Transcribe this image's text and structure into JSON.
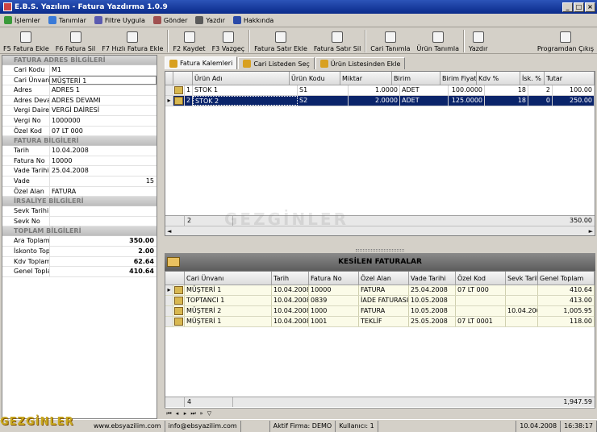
{
  "window": {
    "title": "E.B.S. Yazılım   -   Fatura Yazdırma 1.0.9",
    "min": "_",
    "max": "□",
    "close": "×"
  },
  "menu": [
    {
      "label": "İşlemler",
      "color": "#3a9a3a"
    },
    {
      "label": "Tanımlar",
      "color": "#3a7ad8"
    },
    {
      "label": "Filtre Uygula",
      "color": "#5a5ab0"
    },
    {
      "label": "Gönder",
      "color": "#a05050"
    },
    {
      "label": "Yazdır",
      "color": "#5a5a5a"
    },
    {
      "label": "Hakkında",
      "color": "#2a4aa8"
    }
  ],
  "toolbar": {
    "buttons": [
      "F5 Fatura Ekle",
      "F6 Fatura Sil",
      "F7 Hızlı Fatura Ekle",
      "F2 Kaydet",
      "F3 Vazgeç",
      "Fatura Satır Ekle",
      "Fatura Satır Sil",
      "Cari Tanımla",
      "Ürün Tanımla",
      "Yazdır",
      "Programdan Çıkış"
    ]
  },
  "left": {
    "fatura_adres": {
      "title": "FATURA ADRES BİLGİLERİ",
      "rows": [
        [
          "Cari Kodu",
          "M1"
        ],
        [
          "Cari Ünvanı",
          "MÜŞTERİ 1"
        ],
        [
          "Adres",
          "ADRES 1"
        ],
        [
          "Adres Devamı",
          "ADRES DEVAMI"
        ],
        [
          "Vergi Dairesi",
          "VERGİ DAİRESİ"
        ],
        [
          "Vergi No",
          "1000000"
        ],
        [
          "Özel Kod",
          "07 LT 000"
        ]
      ]
    },
    "fatura": {
      "title": "FATURA BİLGİLERİ",
      "rows": [
        [
          "Tarih",
          "10.04.2008"
        ],
        [
          "Fatura No",
          "10000"
        ],
        [
          "Vade Tarihi",
          "25.04.2008"
        ],
        [
          "Vade",
          ""
        ],
        [
          "Özel Alan",
          "FATURA"
        ]
      ],
      "vade_value": "15"
    },
    "irsaliye": {
      "title": "İRSALİYE BİLGİLERİ",
      "rows": [
        [
          "Sevk Tarihi",
          ""
        ],
        [
          "Sevk No",
          ""
        ]
      ]
    },
    "toplam": {
      "title": "TOPLAM BİLGİLERİ",
      "rows": [
        [
          "Ara Toplam",
          "350.00"
        ],
        [
          "İskonto Toplam",
          "2.00"
        ],
        [
          "Kdv Toplamı",
          "62.64"
        ],
        [
          "Genel Toplam",
          "410.64"
        ]
      ]
    }
  },
  "tabs": [
    "Fatura Kalemleri",
    "Cari Listeden Seç",
    "Ürün Listesinden Ekle"
  ],
  "grid1": {
    "headers": [
      "Ürün Adı",
      "Ürün Kodu",
      "Miktar",
      "Birim",
      "Birim Fiyat",
      "Kdv %",
      "İsk. %",
      "Tutar"
    ],
    "rows": [
      [
        "1",
        "STOK 1",
        "S1",
        "1.0000",
        "ADET",
        "100.0000",
        "18",
        "2",
        "100.00"
      ],
      [
        "2",
        "STOK 2",
        "S2",
        "2.0000",
        "ADET",
        "125.0000",
        "18",
        "0",
        "250.00"
      ]
    ],
    "footer_count": "2",
    "footer_total": "350.00"
  },
  "panel2": {
    "title": "KESİLEN FATURALAR"
  },
  "grid2": {
    "headers": [
      "Cari Ünvanı",
      "Tarih",
      "Fatura No",
      "Özel Alan",
      "Vade Tarihi",
      "Özel Kod",
      "Sevk Tarihi",
      "Genel Toplam"
    ],
    "rows": [
      [
        "MÜŞTERİ 1",
        "10.04.2008",
        "10000",
        "FATURA",
        "25.04.2008",
        "07 LT 000",
        "",
        "410.64"
      ],
      [
        "TOPTANCI 1",
        "10.04.2008",
        "0839",
        "İADE FATURASI",
        "10.05.2008",
        "",
        "",
        "413.00"
      ],
      [
        "MÜŞTERİ 2",
        "10.04.2008",
        "1000",
        "FATURA",
        "10.05.2008",
        "",
        "10.04.2008",
        "1,005.95"
      ],
      [
        "MÜŞTERİ 1",
        "10.04.2008",
        "1001",
        "TEKLİF",
        "25.05.2008",
        "07 LT 0001",
        "",
        "118.00"
      ]
    ],
    "footer_count": "4",
    "footer_total": "1,947.59"
  },
  "status": {
    "web": "www.ebsyazilim.com",
    "email": "info@ebsyazilim.com",
    "firma": "Aktif Firma: DEMO",
    "kullanici": "Kullanıcı: 1",
    "date": "10.04.2008",
    "time": "16:38:17"
  },
  "watermarks": {
    "center": "GEZGİNLER",
    "corner": "GEZGİNLER"
  }
}
